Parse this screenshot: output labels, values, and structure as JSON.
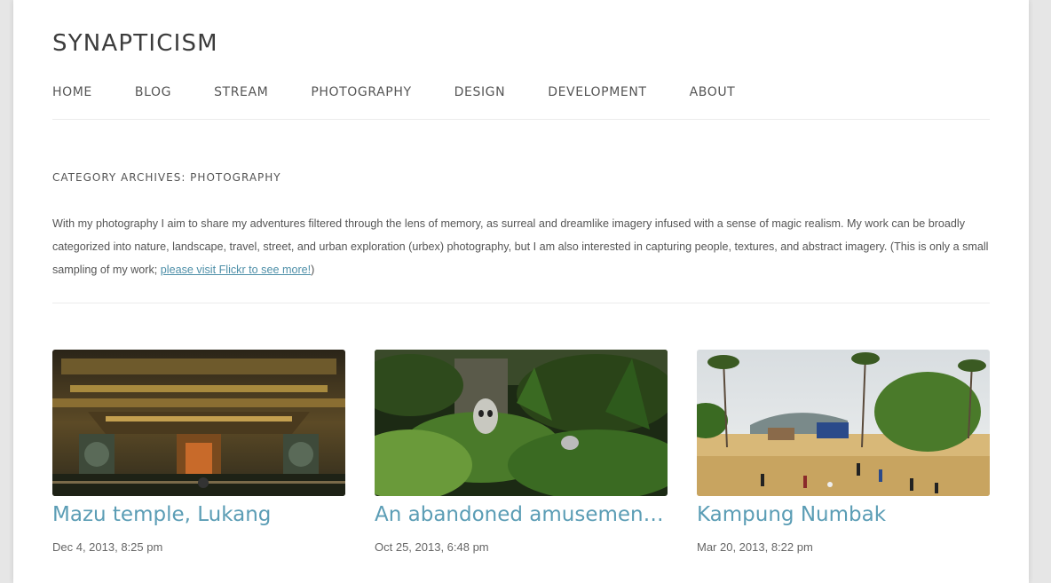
{
  "site": {
    "title": "SYNAPTICISM"
  },
  "nav": {
    "items": [
      {
        "label": "HOME"
      },
      {
        "label": "BLOG"
      },
      {
        "label": "STREAM"
      },
      {
        "label": "PHOTOGRAPHY"
      },
      {
        "label": "DESIGN"
      },
      {
        "label": "DEVELOPMENT"
      },
      {
        "label": "ABOUT"
      }
    ]
  },
  "archive": {
    "title": "CATEGORY ARCHIVES: PHOTOGRAPHY",
    "description_before": "With my photography I aim to share my adventures filtered through the lens of memory, as surreal and dreamlike imagery infused with a sense of magic realism. My work can be broadly categorized into nature, landscape, travel, street, and urban exploration (urbex) photography, but I am also interested in capturing people, textures, and abstract imagery. (This is only a small sampling of my work; ",
    "description_link": "please visit Flickr to see more!",
    "description_after": ")"
  },
  "posts": [
    {
      "title": "Mazu temple, Lukang",
      "date": "Dec 4, 2013, 8:25 pm"
    },
    {
      "title": "An abandoned amusement park",
      "date": "Oct 25, 2013, 6:48 pm"
    },
    {
      "title": "Kampung Numbak",
      "date": "Mar 20, 2013, 8:22 pm"
    }
  ],
  "colors": {
    "link": "#4e8fa8",
    "post_title": "#5b9db5",
    "background": "#e6e6e6"
  }
}
